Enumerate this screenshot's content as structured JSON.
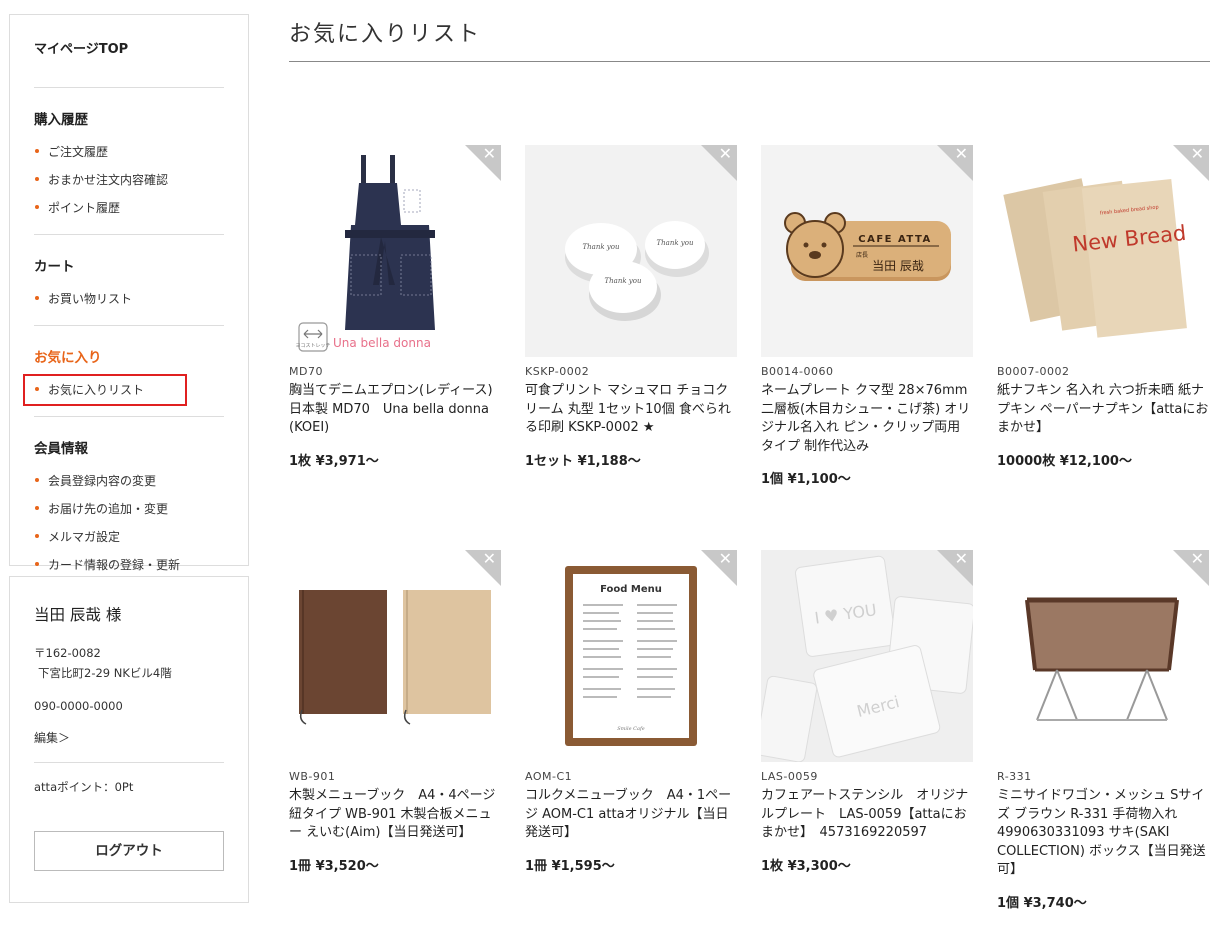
{
  "sidebar": {
    "top_label": "マイページTOP",
    "sections": [
      {
        "heading": "購入履歴",
        "items": [
          "ご注文履歴",
          "おまかせ注文内容確認",
          "ポイント履歴"
        ]
      },
      {
        "heading": "カート",
        "items": [
          "お買い物リスト"
        ]
      },
      {
        "heading": "お気に入り",
        "items": [
          "お気に入りリスト"
        ]
      },
      {
        "heading": "会員情報",
        "items": [
          "会員登録内容の変更",
          "お届け先の追加・変更",
          "メルマガ設定",
          "カード情報の登録・更新"
        ]
      }
    ]
  },
  "user": {
    "name": "当田 辰哉 様",
    "postal": "〒162-0082",
    "address": "下宮比町2-29 NKビル4階",
    "tel": "090-0000-0000",
    "edit_label": "編集＞",
    "points": "attaポイント：0Pt",
    "logout_label": "ログアウト"
  },
  "main": {
    "title": "お気に入りリスト",
    "remove_icon": "✕",
    "products": [
      {
        "code": "MD70",
        "name": "胸当てデニムエプロン(レディース) 日本製 MD70　Una bella donna (KOEI)",
        "price": "1枚 ¥3,971〜",
        "image": "denim-apron",
        "brand_text": "Una bella donna",
        "stretch_text": "ヨコストレッチ"
      },
      {
        "code": "KSKP-0002",
        "name": "可食プリント マシュマロ チョコクリーム 丸型 1セット10個 食べられる印刷 KSKP-0002 ★",
        "price": "1セット ¥1,188〜",
        "image": "marshmallows",
        "print_text": "Thank you"
      },
      {
        "code": "B0014-0060",
        "name": "ネームプレート クマ型 28×76mm 二層板(木目カシュー・こげ茶) オリジナル名入れ ピン・クリップ両用タイプ 制作代込み",
        "price": "1個 ¥1,100〜",
        "image": "bear-nameplate",
        "plate_title": "CAFE ATTA",
        "plate_role": "店長",
        "plate_name": "当田 辰哉"
      },
      {
        "code": "B0007-0002",
        "name": "紙ナフキン 名入れ 六つ折未晒 紙ナプキン ペーパーナプキン【attaにおまかせ】",
        "price": "10000枚 ¥12,100〜",
        "image": "paper-napkins",
        "napkin_small": "fresh baked bread shop",
        "napkin_big": "New Bread"
      },
      {
        "code": "WB-901",
        "name": "木製メニューブック　A4・4ページ 紐タイプ WB-901 木製合板メニュー えいむ(Aim)【当日発送可】",
        "price": "1冊 ¥3,520〜",
        "image": "wooden-menus"
      },
      {
        "code": "AOM-C1",
        "name": "コルクメニューブック　A4・1ページ AOM-C1 attaオリジナル【当日発送可】",
        "price": "1冊 ¥1,595〜",
        "image": "cork-menu",
        "menu_title": "Food Menu",
        "menu_footer": "Smile Cafe"
      },
      {
        "code": "LAS-0059",
        "name": "カフェアートステンシル　オリジナルプレート　LAS-0059【attaにおまかせ】　4573169220597",
        "price": "1枚 ¥3,300〜",
        "image": "stencils",
        "stencil_a": "I ♥ YOU",
        "stencil_b": "Merci"
      },
      {
        "code": "R-331",
        "name": "ミニサイドワゴン・メッシュ Sサイズ ブラウン R-331 手荷物入れ 4990630331093 サキ(SAKI COLLECTION) ボックス【当日発送可】",
        "price": "1個 ¥3,740〜",
        "image": "mesh-wagon"
      }
    ]
  },
  "colors": {
    "accent": "#e8651a",
    "highlight_border": "#e02020",
    "remove_corner": "#c8c8c8"
  }
}
